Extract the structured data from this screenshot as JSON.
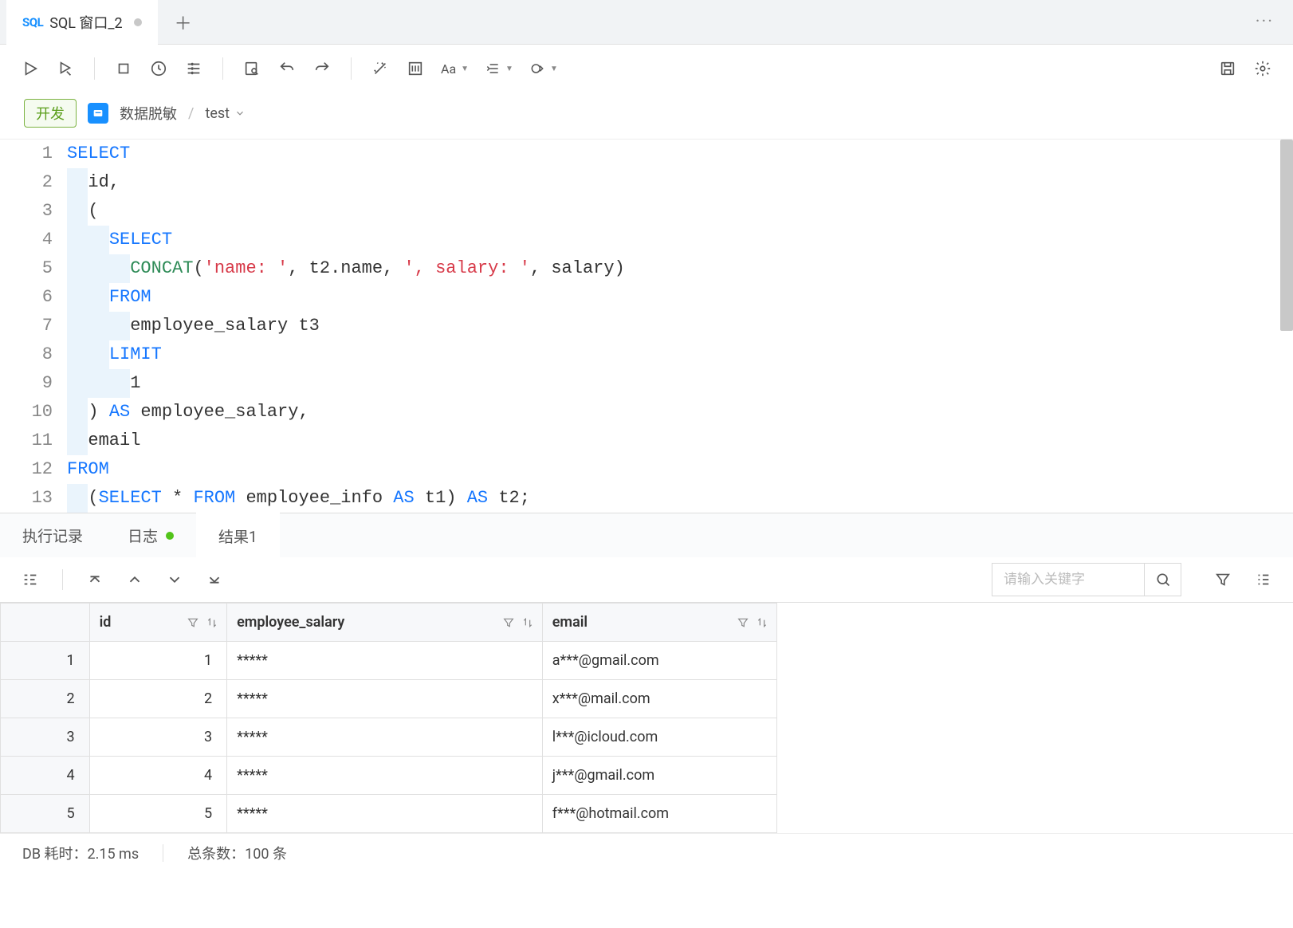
{
  "tab": {
    "icon_text": "SQL",
    "title": "SQL 窗口_2"
  },
  "context": {
    "dev_label": "开发",
    "mask_label": "数据脱敏",
    "db_label": "test"
  },
  "editor": {
    "lines": [
      [
        {
          "cls": "kw",
          "t": "SELECT"
        }
      ],
      [
        {
          "cls": "indent-bg",
          "t": "  "
        },
        {
          "cls": "id",
          "t": "id"
        },
        {
          "cls": "op",
          "t": ","
        }
      ],
      [
        {
          "cls": "indent-bg",
          "t": "  "
        },
        {
          "cls": "op",
          "t": "("
        }
      ],
      [
        {
          "cls": "indent-bg",
          "t": "    "
        },
        {
          "cls": "kw",
          "t": "SELECT"
        }
      ],
      [
        {
          "cls": "indent-bg",
          "t": "      "
        },
        {
          "cls": "fn",
          "t": "CONCAT"
        },
        {
          "cls": "op",
          "t": "("
        },
        {
          "cls": "str",
          "t": "'name: '"
        },
        {
          "cls": "op",
          "t": ", t2.name, "
        },
        {
          "cls": "str",
          "t": "', salary: '"
        },
        {
          "cls": "op",
          "t": ", salary"
        },
        {
          "cls": "op",
          "t": ")"
        }
      ],
      [
        {
          "cls": "indent-bg",
          "t": "    "
        },
        {
          "cls": "kw",
          "t": "FROM"
        }
      ],
      [
        {
          "cls": "indent-bg",
          "t": "      "
        },
        {
          "cls": "id",
          "t": "employee_salary t3"
        }
      ],
      [
        {
          "cls": "indent-bg",
          "t": "    "
        },
        {
          "cls": "kw",
          "t": "LIMIT"
        }
      ],
      [
        {
          "cls": "indent-bg",
          "t": "      "
        },
        {
          "cls": "id",
          "t": "1"
        }
      ],
      [
        {
          "cls": "indent-bg",
          "t": "  "
        },
        {
          "cls": "op",
          "t": ") "
        },
        {
          "cls": "kw",
          "t": "AS"
        },
        {
          "cls": "id",
          "t": " employee_salary"
        },
        {
          "cls": "op",
          "t": ","
        }
      ],
      [
        {
          "cls": "indent-bg",
          "t": "  "
        },
        {
          "cls": "id",
          "t": "email"
        }
      ],
      [
        {
          "cls": "kw",
          "t": "FROM"
        }
      ],
      [
        {
          "cls": "indent-bg",
          "t": "  "
        },
        {
          "cls": "op",
          "t": "("
        },
        {
          "cls": "kw",
          "t": "SELECT"
        },
        {
          "cls": "op",
          "t": " * "
        },
        {
          "cls": "kw",
          "t": "FROM"
        },
        {
          "cls": "id",
          "t": " employee_info "
        },
        {
          "cls": "kw",
          "t": "AS"
        },
        {
          "cls": "id",
          "t": " t1"
        },
        {
          "cls": "op",
          "t": ") "
        },
        {
          "cls": "kw",
          "t": "AS"
        },
        {
          "cls": "id",
          "t": " t2"
        },
        {
          "cls": "op",
          "t": ";"
        }
      ]
    ]
  },
  "result_tabs": {
    "history": "执行记录",
    "log": "日志",
    "result": "结果1"
  },
  "search": {
    "placeholder": "请输入关键字"
  },
  "columns": {
    "id": "id",
    "salary": "employee_salary",
    "email": "email"
  },
  "rows": [
    {
      "n": "1",
      "id": "1",
      "salary": "*****",
      "email": "a***@gmail.com"
    },
    {
      "n": "2",
      "id": "2",
      "salary": "*****",
      "email": "x***@mail.com"
    },
    {
      "n": "3",
      "id": "3",
      "salary": "*****",
      "email": "l***@icloud.com"
    },
    {
      "n": "4",
      "id": "4",
      "salary": "*****",
      "email": "j***@gmail.com"
    },
    {
      "n": "5",
      "id": "5",
      "salary": "*****",
      "email": "f***@hotmail.com"
    }
  ],
  "status": {
    "time_label": "DB 耗时：",
    "time_value": "2.15 ms",
    "count_label": "总条数：",
    "count_value": "100 条"
  }
}
